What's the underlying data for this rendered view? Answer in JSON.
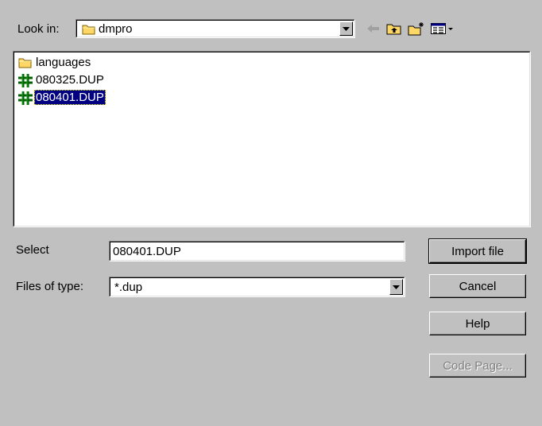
{
  "look_in": {
    "label": "Look in:",
    "value": "dmpro"
  },
  "toolbar": {
    "back_icon": "back-arrow-icon",
    "up_icon": "up-one-level-icon",
    "new_folder_icon": "new-folder-icon",
    "view_icon": "view-menu-icon"
  },
  "files": [
    {
      "name": "languages",
      "type": "folder",
      "selected": false
    },
    {
      "name": "080325.DUP",
      "type": "dup",
      "selected": false
    },
    {
      "name": "080401.DUP",
      "type": "dup",
      "selected": true
    }
  ],
  "select": {
    "label": "Select",
    "value": "080401.DUP"
  },
  "files_of_type": {
    "label": "Files of type:",
    "value": "*.dup"
  },
  "buttons": {
    "import": "Import file",
    "cancel": "Cancel",
    "help": "Help",
    "code_page": "Code Page..."
  },
  "colors": {
    "face": "#c0c0c0",
    "selection": "#000080",
    "folder": "#ffd766",
    "dup_icon": "#008000"
  }
}
